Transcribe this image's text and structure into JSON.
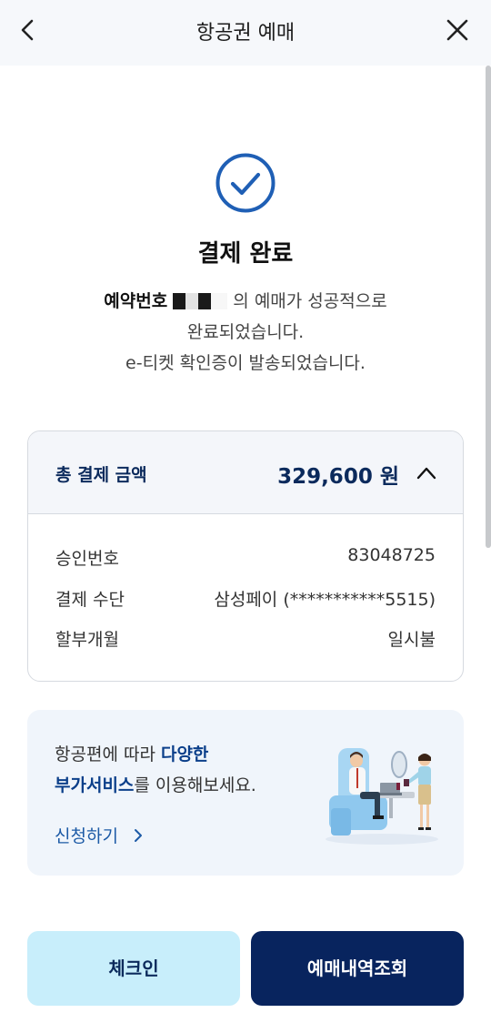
{
  "header": {
    "title": "항공권 예매"
  },
  "status": {
    "title": "결제 완료",
    "booking_label": "예약번호",
    "line1_rest": "의 예매가 성공적으로",
    "line2": "완료되었습니다.",
    "line3": "e-티켓 확인증이 발송되었습니다."
  },
  "payment": {
    "total_label": "총 결제 금액",
    "total_amount": "329,600 원",
    "rows": [
      {
        "label": "승인번호",
        "value": "83048725"
      },
      {
        "label": "결제 수단",
        "value": "삼성페이 (***********5515)"
      },
      {
        "label": "할부개월",
        "value": "일시불"
      }
    ]
  },
  "promo": {
    "prefix": "항공편에 따라 ",
    "highlight1": "다양한",
    "highlight2": "부가서비스",
    "suffix": "를 이용해보세요.",
    "apply_label": "신청하기"
  },
  "buttons": {
    "checkin": "체크인",
    "history": "예매내역조회"
  },
  "colors": {
    "navy": "#08245e",
    "accent": "#1c5aa6",
    "check": "#1f5fb5",
    "light_button": "#c8eefb"
  }
}
